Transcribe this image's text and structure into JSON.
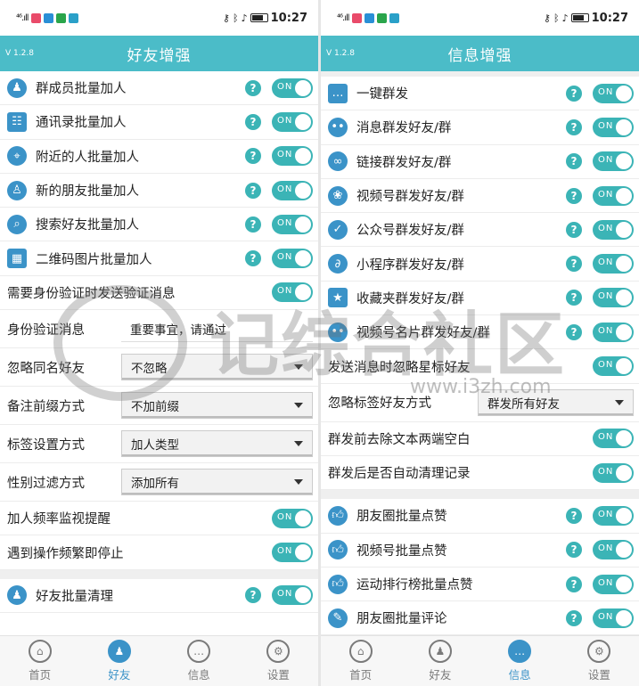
{
  "status": {
    "time": "10:27",
    "signal": "⁴⁶.ıll"
  },
  "left": {
    "version": "V 1.2.8",
    "title": "好友增强",
    "toggle_label": "ON",
    "rows": [
      {
        "label": "群成员批量加人",
        "icon": "group-members-icon"
      },
      {
        "label": "通讯录批量加人",
        "icon": "contacts-icon"
      },
      {
        "label": "附近的人批量加人",
        "icon": "nearby-people-icon"
      },
      {
        "label": "新的朋友批量加人",
        "icon": "new-friend-icon"
      },
      {
        "label": "搜索好友批量加人",
        "icon": "search-icon"
      },
      {
        "label": "二维码图片批量加人",
        "icon": "qr-code-icon"
      }
    ],
    "verify_msg_toggle": "需要身份验证时发送验证消息",
    "verify_msg_label": "身份验证消息",
    "verify_msg_value": "重要事宜，请通过",
    "dup_name_label": "忽略同名好友",
    "dup_name_value": "不忽略",
    "remark_label": "备注前缀方式",
    "remark_value": "不加前缀",
    "tag_label": "标签设置方式",
    "tag_value": "加人类型",
    "gender_label": "性别过滤方式",
    "gender_value": "添加所有",
    "freq_monitor": "加人频率监视提醒",
    "freq_stop": "遇到操作频繁即停止",
    "cleanup": "好友批量清理"
  },
  "right": {
    "version": "V 1.2.8",
    "title": "信息增强",
    "rows": [
      {
        "label": "一键群发",
        "icon": "chat-bubble-icon"
      },
      {
        "label": "消息群发好友/群",
        "icon": "message-icon"
      },
      {
        "label": "链接群发好友/群",
        "icon": "link-icon"
      },
      {
        "label": "视频号群发好友/群",
        "icon": "video-channel-icon"
      },
      {
        "label": "公众号群发好友/群",
        "icon": "official-account-icon"
      },
      {
        "label": "小程序群发好友/群",
        "icon": "mini-program-icon"
      },
      {
        "label": "收藏夹群发好友/群",
        "icon": "favorites-icon"
      },
      {
        "label": "视频号名片群发好友/群",
        "icon": "video-card-icon"
      }
    ],
    "ignore_star": "发送消息时忽略星标好友",
    "ignore_tag_label": "忽略标签好友方式",
    "ignore_tag_value": "群发所有好友",
    "trim_text": "群发前去除文本两端空白",
    "auto_clean": "群发后是否自动清理记录",
    "rows2": [
      {
        "label": "朋友圈批量点赞",
        "icon": "thumbs-up-icon"
      },
      {
        "label": "视频号批量点赞",
        "icon": "thumbs-up-icon"
      },
      {
        "label": "运动排行榜批量点赞",
        "icon": "thumbs-up-icon"
      },
      {
        "label": "朋友圈批量评论",
        "icon": "comment-icon"
      }
    ]
  },
  "tabs": [
    "首页",
    "好友",
    "信息",
    "设置"
  ],
  "watermark": {
    "brand": "记综合社区",
    "site": "www.i3zh.com"
  },
  "colors": {
    "accent": "#4bbcc8",
    "toggle": "#3bb4b6",
    "icon": "#3b93c8"
  }
}
